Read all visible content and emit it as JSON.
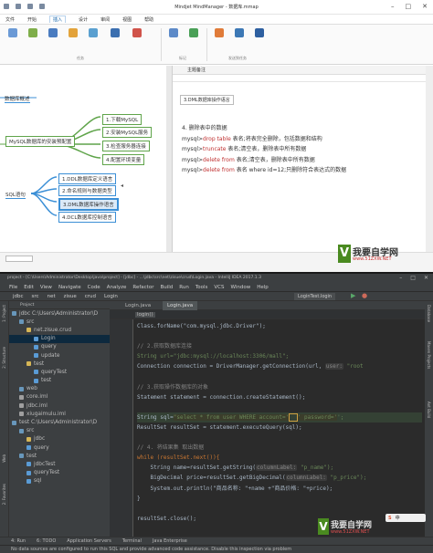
{
  "mm": {
    "title": "Mindjet MindManager - 数据库.mmap",
    "menu": [
      "文件",
      "开始",
      "插入",
      "设计",
      "审阅",
      "视图",
      "帮助"
    ],
    "ribbon": {
      "sections": [
        "任务",
        "标记",
        "发送到任务"
      ]
    },
    "map": {
      "central": "MySQL数据库的安装预配置",
      "top": "数据库概述",
      "sql": "SQL语句",
      "install_children": [
        "1.下载MySQL",
        "2.安装MySQL服务",
        "3.检查服务器连接",
        "4.配置环境变量"
      ],
      "sql_children": [
        "1.DDL数据库定义语言",
        "2.命名规则与数据类型",
        "3.DML数据库操作语言",
        "4.DCL数据库控制语言"
      ]
    },
    "notes": {
      "header": "主题备注",
      "breadcrumb": "3.DML数据库操作语言",
      "lines": [
        {
          "p": "4. 删除表中的数据",
          "k": "",
          "r": ""
        },
        {
          "p": "mysql>",
          "k": "drop table",
          "r": " 表名;将表完全删除，包括数据和结构"
        },
        {
          "p": "mysql>",
          "k": "truncate",
          "r": " 表名;清空表，删除表中所有数据"
        },
        {
          "p": "mysql>",
          "k": "delete from",
          "r": " 表名;清空表，删除表中所有数据"
        },
        {
          "p": "mysql>",
          "k": "delete from",
          "r": " 表名 where id=12;只删除符合表达式的数据"
        }
      ]
    },
    "status": "",
    "watermark": {
      "text": "我要自学网",
      "url": "www.51ZXW.NET"
    }
  },
  "ij": {
    "title": "project - [C:\\Users\\Administrator\\Desktop\\java\\project] - [jdbc] - ...\\jdbc\\src\\net\\zisue\\crud\\Login.java - IntelliJ IDEA 2017.1.3",
    "menu": [
      "File",
      "Edit",
      "View",
      "Navigate",
      "Code",
      "Analyze",
      "Refactor",
      "Build",
      "Run",
      "Tools",
      "VCS",
      "Window",
      "Help"
    ],
    "nav": [
      "jdbc",
      "src",
      "net",
      "zisue",
      "crud",
      "Login"
    ],
    "project_header": "Project",
    "tree": [
      {
        "t": "jdbc  C:\\Users\\Administrator\\D",
        "d": 0,
        "c": "#6897bb"
      },
      {
        "t": "src",
        "d": 1,
        "c": "#6897bb"
      },
      {
        "t": "net.zisue.crud",
        "d": 2,
        "c": "#d6b656"
      },
      {
        "t": "Login",
        "d": 3,
        "c": "#5a9bd5"
      },
      {
        "t": "query",
        "d": 3,
        "c": "#5a9bd5"
      },
      {
        "t": "update",
        "d": 3,
        "c": "#5a9bd5"
      },
      {
        "t": "test",
        "d": 2,
        "c": "#d6b656"
      },
      {
        "t": "queryTest",
        "d": 3,
        "c": "#5a9bd5"
      },
      {
        "t": "test",
        "d": 3,
        "c": "#5a9bd5"
      },
      {
        "t": "web",
        "d": 1,
        "c": "#6897bb"
      },
      {
        "t": "core.iml",
        "d": 1,
        "c": "#9f9f9f"
      },
      {
        "t": "jdbc.iml",
        "d": 1,
        "c": "#9f9f9f"
      },
      {
        "t": "xiugaimulu.iml",
        "d": 1,
        "c": "#9f9f9f"
      },
      {
        "t": "test  C:\\Users\\Administrator\\D",
        "d": 0,
        "c": "#6897bb"
      },
      {
        "t": "src",
        "d": 1,
        "c": "#6897bb"
      },
      {
        "t": "jdbc",
        "d": 2,
        "c": "#d6b656"
      },
      {
        "t": "query",
        "d": 2,
        "c": "#5a9bd5"
      },
      {
        "t": "test",
        "d": 1,
        "c": "#6897bb"
      },
      {
        "t": "jdbcTest",
        "d": 2,
        "c": "#5a9bd5"
      },
      {
        "t": "queryTest",
        "d": 2,
        "c": "#5a9bd5"
      },
      {
        "t": "sql",
        "d": 2,
        "c": "#5a9bd5"
      }
    ],
    "tabs": [
      "Login.java",
      "Login.java"
    ],
    "run_config": "LoginTest.login",
    "breadcrumb": "login()",
    "left_tools": [
      "1: Project",
      "2: Structure",
      "Web",
      "2: Favorites"
    ],
    "right_tools": [
      "Database",
      "Maven Projects",
      "Ant Build"
    ],
    "code": {
      "l1": "Class.forName(\"com.mysql.jdbc.Driver\");",
      "l2": "// 2.获取数据库连接",
      "l3a": "String url=\"jdbc:mysql://localhost:3306/mall\";",
      "l4a": "Connection connection = DriverManager.getConnection(url,",
      "l4h": "user:",
      "l4b": " \"root",
      "l5": "// 3.获取操作数据库的对象",
      "l6": "Statement statement = connection.createStatement();",
      "l7a": "String sql=",
      "l7b": "\"select * from user WHERE account='",
      "l7c": "' password='",
      "l7d": "';",
      "l8": "ResultSet resultSet = statement.executeQuery(sql);",
      "l9": "// 4. 将结果集 取出数据",
      "l10": "while (resultSet.next()){",
      "l11a": "String name=resultSet.getString(",
      "l11h": "columnLabel:",
      "l11b": " \"p_name\");",
      "l12a": "BigDecimal price=resultSet.getBigDecimal(",
      "l12h": "columnLabel:",
      "l12b": " \"p_price\");",
      "l13": "System.out.println(\"商品名称: \"+name +\"商品价格: \"+price);",
      "l14": "}",
      "l15": "resultSet.close();"
    },
    "bottom_tools": [
      "4: Run",
      "6: TODO",
      "Application Servers",
      "Terminal",
      "Java Enterprise"
    ],
    "status": "No data sources are configured to run this SQL and provide advanced code assistance. Disable this inspection via problem",
    "ime": [
      "S",
      "中"
    ],
    "watermark": {
      "text": "我要自学网",
      "url": "www.51ZXW.NET"
    }
  }
}
